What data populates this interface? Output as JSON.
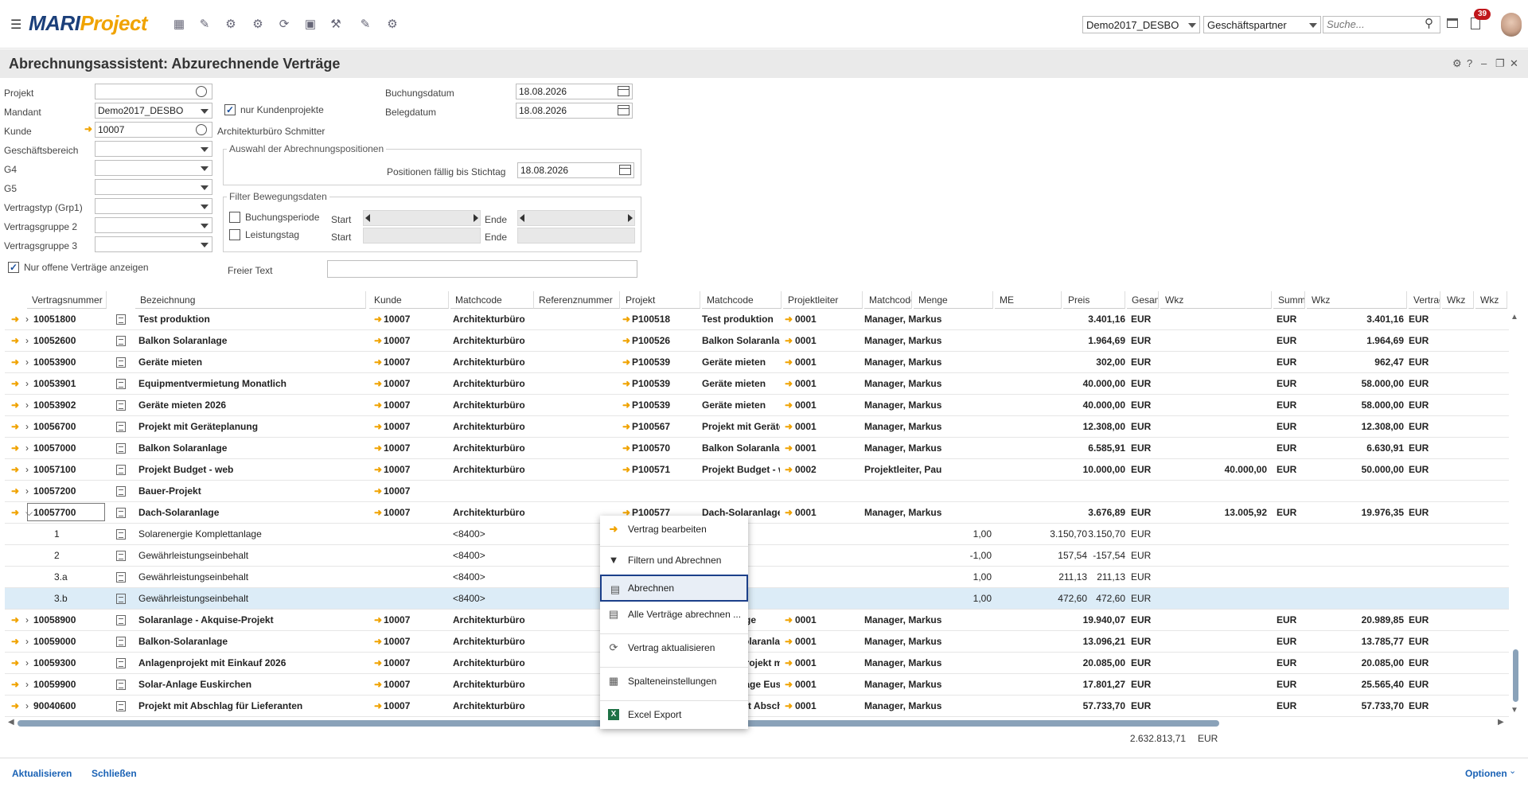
{
  "header": {
    "logo_mari": "MARI",
    "logo_project": "Project",
    "client_select": "Demo2017_DESBO",
    "scope_select": "Geschäftspartner",
    "search_placeholder": "Suche...",
    "notification_count": "39"
  },
  "page": {
    "title": "Abrechnungsassistent: Abzurechnende Verträge"
  },
  "form": {
    "projekt_label": "Projekt",
    "projekt_value": "",
    "mandant_label": "Mandant",
    "mandant_value": "Demo2017_DESBO",
    "nur_kundenprojekte_label": "nur Kundenprojekte",
    "kunde_label": "Kunde",
    "kunde_value": "10007",
    "kunde_name": "Architekturbüro Schmitter",
    "geschaeftsbereich_label": "Geschäftsbereich",
    "g4_label": "G4",
    "g5_label": "G5",
    "vertragstyp_label": "Vertragstyp (Grp1)",
    "vertragsgruppe2_label": "Vertragsgruppe 2",
    "vertragsgruppe3_label": "Vertragsgruppe 3",
    "nur_offene_label": "Nur offene Verträge anzeigen",
    "buchungsdatum_label": "Buchungsdatum",
    "buchungsdatum_value": "18.08.2026",
    "belegdatum_label": "Belegdatum",
    "belegdatum_value": "18.08.2026",
    "auswahl_title": "Auswahl der Abrechnungspositionen",
    "positionen_label": "Positionen fällig bis Stichtag",
    "positionen_value": "18.08.2026",
    "filter_title": "Filter Bewegungsdaten",
    "buchungsperiode_label": "Buchungsperiode",
    "leistungstag_label": "Leistungstag",
    "start_label": "Start",
    "ende_label": "Ende",
    "freier_text_label": "Freier Text"
  },
  "table": {
    "columns": [
      "Vertragsnummer",
      "Bezeichnung",
      "Kunde",
      "Matchcode",
      "Referenznummer",
      "Projekt",
      "Matchcode",
      "Projektleiter",
      "Matchcode",
      "Menge",
      "ME",
      "Preis",
      "Gesamt",
      "Wkz",
      "Summe abgerechnet",
      "Wkz",
      "Vertragsvolumen",
      "Wkz",
      "Wkz"
    ],
    "rows": [
      {
        "nr": "10051800",
        "bez": "Test produktion",
        "kunde": "10007",
        "match": "Architekturbüro",
        "projekt": "P100518",
        "pmatch": "Test produktion",
        "pl": "0001",
        "plmatch": "Manager, Markus",
        "menge": "",
        "preis": "",
        "gesamt": "3.401,16",
        "wkz": "EUR",
        "summe": "",
        "wkz2": "EUR",
        "vol": "3.401,16",
        "wkz3": "EUR"
      },
      {
        "nr": "10052600",
        "bez": "Balkon Solaranlage",
        "kunde": "10007",
        "match": "Architekturbüro",
        "projekt": "P100526",
        "pmatch": "Balkon Solaranlage",
        "pl": "0001",
        "plmatch": "Manager, Markus",
        "menge": "",
        "preis": "",
        "gesamt": "1.964,69",
        "wkz": "EUR",
        "summe": "",
        "wkz2": "EUR",
        "vol": "1.964,69",
        "wkz3": "EUR"
      },
      {
        "nr": "10053900",
        "bez": "Geräte mieten",
        "kunde": "10007",
        "match": "Architekturbüro",
        "projekt": "P100539",
        "pmatch": "Geräte mieten",
        "pl": "0001",
        "plmatch": "Manager, Markus",
        "menge": "",
        "preis": "",
        "gesamt": "302,00",
        "wkz": "EUR",
        "summe": "",
        "wkz2": "EUR",
        "vol": "962,47",
        "wkz3": "EUR"
      },
      {
        "nr": "10053901",
        "bez": "Equipmentvermietung Monatlich",
        "kunde": "10007",
        "match": "Architekturbüro",
        "projekt": "P100539",
        "pmatch": "Geräte mieten",
        "pl": "0001",
        "plmatch": "Manager, Markus",
        "menge": "",
        "preis": "",
        "gesamt": "40.000,00",
        "wkz": "EUR",
        "summe": "",
        "wkz2": "EUR",
        "vol": "58.000,00",
        "wkz3": "EUR"
      },
      {
        "nr": "10053902",
        "bez": "Geräte mieten 2026",
        "kunde": "10007",
        "match": "Architekturbüro",
        "projekt": "P100539",
        "pmatch": "Geräte mieten",
        "pl": "0001",
        "plmatch": "Manager, Markus",
        "menge": "",
        "preis": "",
        "gesamt": "40.000,00",
        "wkz": "EUR",
        "summe": "",
        "wkz2": "EUR",
        "vol": "58.000,00",
        "wkz3": "EUR"
      },
      {
        "nr": "10056700",
        "bez": "Projekt mit Geräteplanung",
        "kunde": "10007",
        "match": "Architekturbüro",
        "projekt": "P100567",
        "pmatch": "Projekt mit Geräteplanung",
        "pl": "0001",
        "plmatch": "Manager, Markus",
        "menge": "",
        "preis": "",
        "gesamt": "12.308,00",
        "wkz": "EUR",
        "summe": "",
        "wkz2": "EUR",
        "vol": "12.308,00",
        "wkz3": "EUR"
      },
      {
        "nr": "10057000",
        "bez": "Balkon Solaranlage",
        "kunde": "10007",
        "match": "Architekturbüro",
        "projekt": "P100570",
        "pmatch": "Balkon Solaranlage",
        "pl": "0001",
        "plmatch": "Manager, Markus",
        "menge": "",
        "preis": "",
        "gesamt": "6.585,91",
        "wkz": "EUR",
        "summe": "",
        "wkz2": "EUR",
        "vol": "6.630,91",
        "wkz3": "EUR"
      },
      {
        "nr": "10057100",
        "bez": "Projekt Budget - web",
        "kunde": "10007",
        "match": "Architekturbüro",
        "projekt": "P100571",
        "pmatch": "Projekt Budget - web",
        "pl": "0002",
        "plmatch": "Projektleiter, Paul",
        "menge": "",
        "preis": "",
        "gesamt": "10.000,00",
        "wkz": "EUR",
        "summe": "40.000,00",
        "wkz2": "EUR",
        "vol": "50.000,00",
        "wkz3": "EUR"
      },
      {
        "nr": "10057200",
        "bez": "Bauer-Projekt",
        "kunde": "10007",
        "match": "",
        "projekt": "",
        "pmatch": "",
        "pl": "",
        "plmatch": "",
        "menge": "",
        "preis": "",
        "gesamt": "",
        "wkz": "",
        "summe": "",
        "wkz2": "",
        "vol": "",
        "wkz3": ""
      },
      {
        "nr": "10057700",
        "bez": "Dach-Solaranlage",
        "kunde": "10007",
        "match": "Architekturbüro",
        "projekt": "P100577",
        "pmatch": "Dach-Solaranlage",
        "pl": "0001",
        "plmatch": "Manager, Markus",
        "menge": "",
        "preis": "",
        "gesamt": "3.676,89",
        "wkz": "EUR",
        "summe": "13.005,92",
        "wkz2": "EUR",
        "vol": "19.976,35",
        "wkz3": "EUR"
      }
    ],
    "subrows": [
      {
        "nr": "1",
        "bez": "Solarenergie Komplettanlage",
        "match": "<8400>",
        "menge": "1,00",
        "preis": "3.150,70",
        "gesamt": "3.150,70",
        "wkz": "EUR"
      },
      {
        "nr": "2",
        "bez": "Gewährleistungseinbehalt",
        "match": "<8400>",
        "menge": "-1,00",
        "preis": "157,54",
        "gesamt": "-157,54",
        "wkz": "EUR"
      },
      {
        "nr": "3.a",
        "bez": "Gewährleistungseinbehalt",
        "match": "<8400>",
        "menge": "1,00",
        "preis": "211,13",
        "gesamt": "211,13",
        "wkz": "EUR"
      },
      {
        "nr": "3.b",
        "bez": "Gewährleistungseinbehalt",
        "match": "<8400>",
        "menge": "1,00",
        "preis": "472,60",
        "gesamt": "472,60",
        "wkz": "EUR"
      }
    ],
    "rows2": [
      {
        "nr": "10058900",
        "bez": "Solaranlage - Akquise-Projekt",
        "kunde": "10007",
        "match": "Architekturbüro",
        "pmatch": "Solaranlage",
        "pl": "0001",
        "plmatch": "Manager, Markus",
        "gesamt": "19.940,07",
        "wkz": "EUR",
        "wkz2": "EUR",
        "vol": "20.989,85",
        "wkz3": "EUR"
      },
      {
        "nr": "10059000",
        "bez": "Balkon-Solaranlage",
        "kunde": "10007",
        "match": "Architekturbüro",
        "pmatch": "Balkon-Solaranlage",
        "pl": "0001",
        "plmatch": "Manager, Markus",
        "gesamt": "13.096,21",
        "wkz": "EUR",
        "wkz2": "EUR",
        "vol": "13.785,77",
        "wkz3": "EUR"
      },
      {
        "nr": "10059300",
        "bez": "Anlagenprojekt mit Einkauf 2026",
        "kunde": "10007",
        "match": "Architekturbüro",
        "pmatch": "Anlagenprojekt mit",
        "pl": "0001",
        "plmatch": "Manager, Markus",
        "gesamt": "20.085,00",
        "wkz": "EUR",
        "wkz2": "EUR",
        "vol": "20.085,00",
        "wkz3": "EUR"
      },
      {
        "nr": "10059900",
        "bez": "Solar-Anlage Euskirchen",
        "kunde": "10007",
        "match": "Architekturbüro",
        "pmatch": "Solar-Anlage Euskirchen",
        "pl": "0001",
        "plmatch": "Manager, Markus",
        "gesamt": "17.801,27",
        "wkz": "EUR",
        "wkz2": "EUR",
        "vol": "25.565,40",
        "wkz3": "EUR"
      },
      {
        "nr": "90040600",
        "bez": "Projekt mit Abschlag für Lieferanten",
        "kunde": "10007",
        "match": "Architekturbüro",
        "pmatch": "Projekt mit Abschlag",
        "pl": "0001",
        "plmatch": "Manager, Markus",
        "gesamt": "57.733,70",
        "wkz": "EUR",
        "wkz2": "EUR",
        "vol": "57.733,70",
        "wkz3": "EUR"
      }
    ],
    "total": "2.632.813,71",
    "total_wkz": "EUR"
  },
  "context_menu": {
    "items": [
      "Vertrag bearbeiten",
      "Filtern und Abrechnen",
      "Abrechnen",
      "Alle Verträge abrechnen ...",
      "Vertrag aktualisieren",
      "Spalteneinstellungen",
      "Excel Export"
    ],
    "active": "Abrechnen"
  },
  "footer": {
    "aktualisieren": "Aktualisieren",
    "schliessen": "Schließen",
    "optionen": "Optionen"
  }
}
